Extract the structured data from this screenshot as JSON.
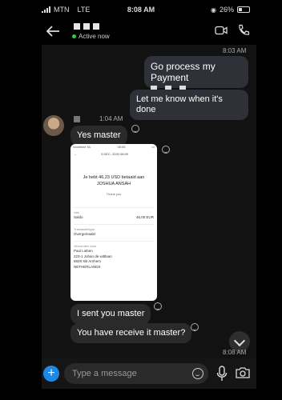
{
  "status_bar": {
    "carrier": "MTN",
    "network": "LTE",
    "time": "8:08 AM",
    "battery": "26%",
    "battery_level": 0.26
  },
  "header": {
    "presence": "Active now"
  },
  "messages": {
    "timestamp_1": "8:03 AM",
    "out_1": "Go process my Payment",
    "out_2": "Let me know when it's done",
    "timestamp_2": "1:04 AM",
    "in_1": "Yes master",
    "in_2": "I sent you master",
    "in_3": "You have receive it master?",
    "timestamp_3": "8:08 AM"
  },
  "receipt": {
    "carrier": "vodafone NL",
    "status_time": "08:05",
    "date": "3 DEC. 2020 08:00",
    "paid_line_1": "Je hebt 46,23 USD betaald aan",
    "paid_line_2": "JOSHUA ANSAH",
    "thanks": "Thank you",
    "from_label": "Van",
    "from_account": "Saldo",
    "from_amount": "46,00 EUR",
    "type_label": "Transactietype",
    "type_value": "Overgemaakt",
    "sender_label": "Verzonden door",
    "sender_name": "Paul Lieben",
    "sender_addr_1": "223-1 Johan de wittlaan",
    "sender_addr_2": "6828 XB Arnhem",
    "sender_addr_3": "NETHERLANDS"
  },
  "compose": {
    "placeholder": "Type a message"
  },
  "colors": {
    "online_dot": "#2ecc40",
    "accent": "#1e88e5"
  }
}
